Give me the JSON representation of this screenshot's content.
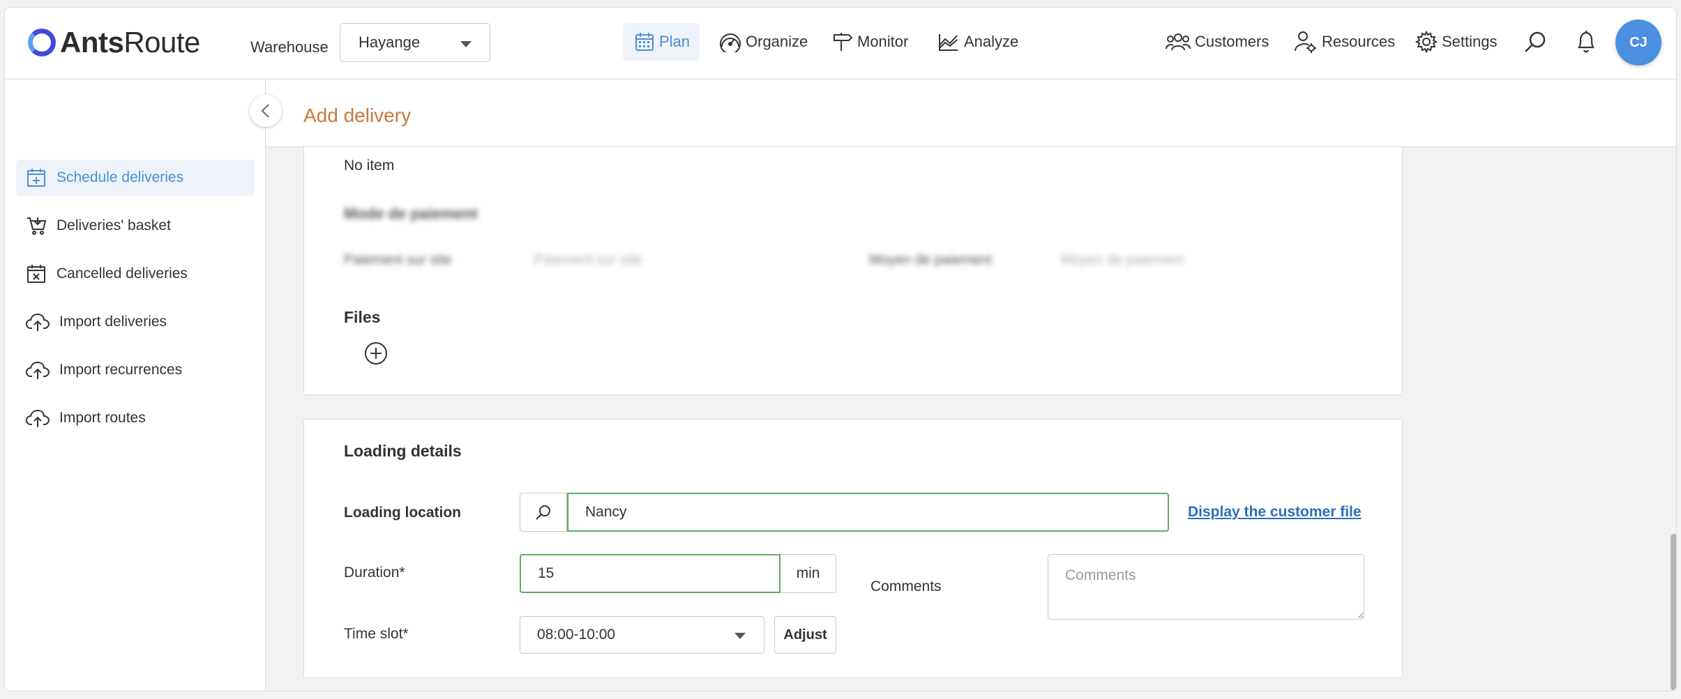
{
  "app": {
    "logo_bold": "Ants",
    "logo_light": "Route",
    "warehouse_label": "Warehouse",
    "warehouse_value": "Hayange",
    "avatar_initials": "CJ",
    "accent_color": "#4a8fd4"
  },
  "nav": {
    "plan": "Plan",
    "organize": "Organize",
    "monitor": "Monitor",
    "analyze": "Analyze",
    "customers": "Customers",
    "resources": "Resources",
    "settings": "Settings"
  },
  "sidebar": {
    "items": [
      {
        "label": "Schedule deliveries",
        "icon": "calendar-plus-icon",
        "active": true
      },
      {
        "label": "Deliveries' basket",
        "icon": "basket-icon"
      },
      {
        "label": "Cancelled deliveries",
        "icon": "calendar-x-icon"
      },
      {
        "label": "Import deliveries",
        "icon": "cloud-upload-icon"
      },
      {
        "label": "Import recurrences",
        "icon": "cloud-upload-icon"
      },
      {
        "label": "Import routes",
        "icon": "cloud-upload-icon"
      }
    ]
  },
  "page": {
    "title": "Add delivery"
  },
  "items_section": {
    "no_item": "No item",
    "blurred_title": "Mode de paiement",
    "blurred_label_1": "Paiement sur site",
    "blurred_value_1": "Paiement sur site",
    "blurred_label_2": "Moyen de paiement",
    "blurred_value_2": "Moyen de paiement",
    "files_title": "Files"
  },
  "loading": {
    "title": "Loading details",
    "location_label": "Loading location",
    "location_value": "Nancy",
    "customer_file_link": "Display the customer file",
    "duration_label": "Duration*",
    "duration_value": "15",
    "duration_unit": "min",
    "comments_label": "Comments",
    "comments_placeholder": "Comments",
    "timeslot_label": "Time slot*",
    "timeslot_value": "08:00-10:00",
    "adjust_label": "Adjust"
  }
}
